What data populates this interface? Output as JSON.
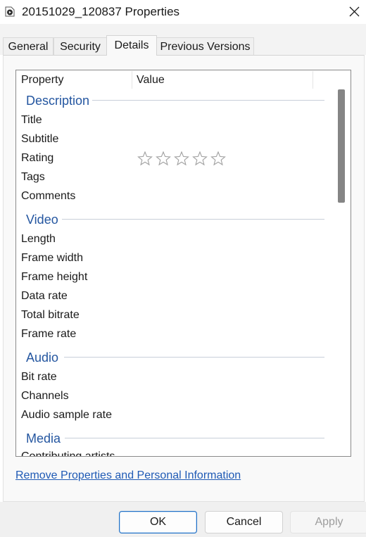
{
  "window": {
    "title": "20151029_120837 Properties"
  },
  "tabs": [
    {
      "label": "General",
      "active": false
    },
    {
      "label": "Security",
      "active": false
    },
    {
      "label": "Details",
      "active": true
    },
    {
      "label": "Previous Versions",
      "active": false
    }
  ],
  "list": {
    "headers": {
      "property": "Property",
      "value": "Value"
    },
    "sections": [
      {
        "label": "Description",
        "items": [
          "Title",
          "Subtitle",
          "Rating",
          "Tags",
          "Comments"
        ]
      },
      {
        "label": "Video",
        "items": [
          "Length",
          "Frame width",
          "Frame height",
          "Data rate",
          "Total bitrate",
          "Frame rate"
        ]
      },
      {
        "label": "Audio",
        "items": [
          "Bit rate",
          "Channels",
          "Audio sample rate"
        ]
      },
      {
        "label": "Media",
        "items": []
      }
    ],
    "rating": {
      "stars_filled": 0,
      "stars_total": 5
    },
    "clipped_row": "Contributing artists"
  },
  "link": {
    "label": "Remove Properties and Personal Information"
  },
  "buttons": {
    "ok": "OK",
    "cancel": "Cancel",
    "apply": "Apply"
  },
  "colors": {
    "accent": "#1f6fc5",
    "section": "#2456a0",
    "link": "#1f5ab5"
  }
}
